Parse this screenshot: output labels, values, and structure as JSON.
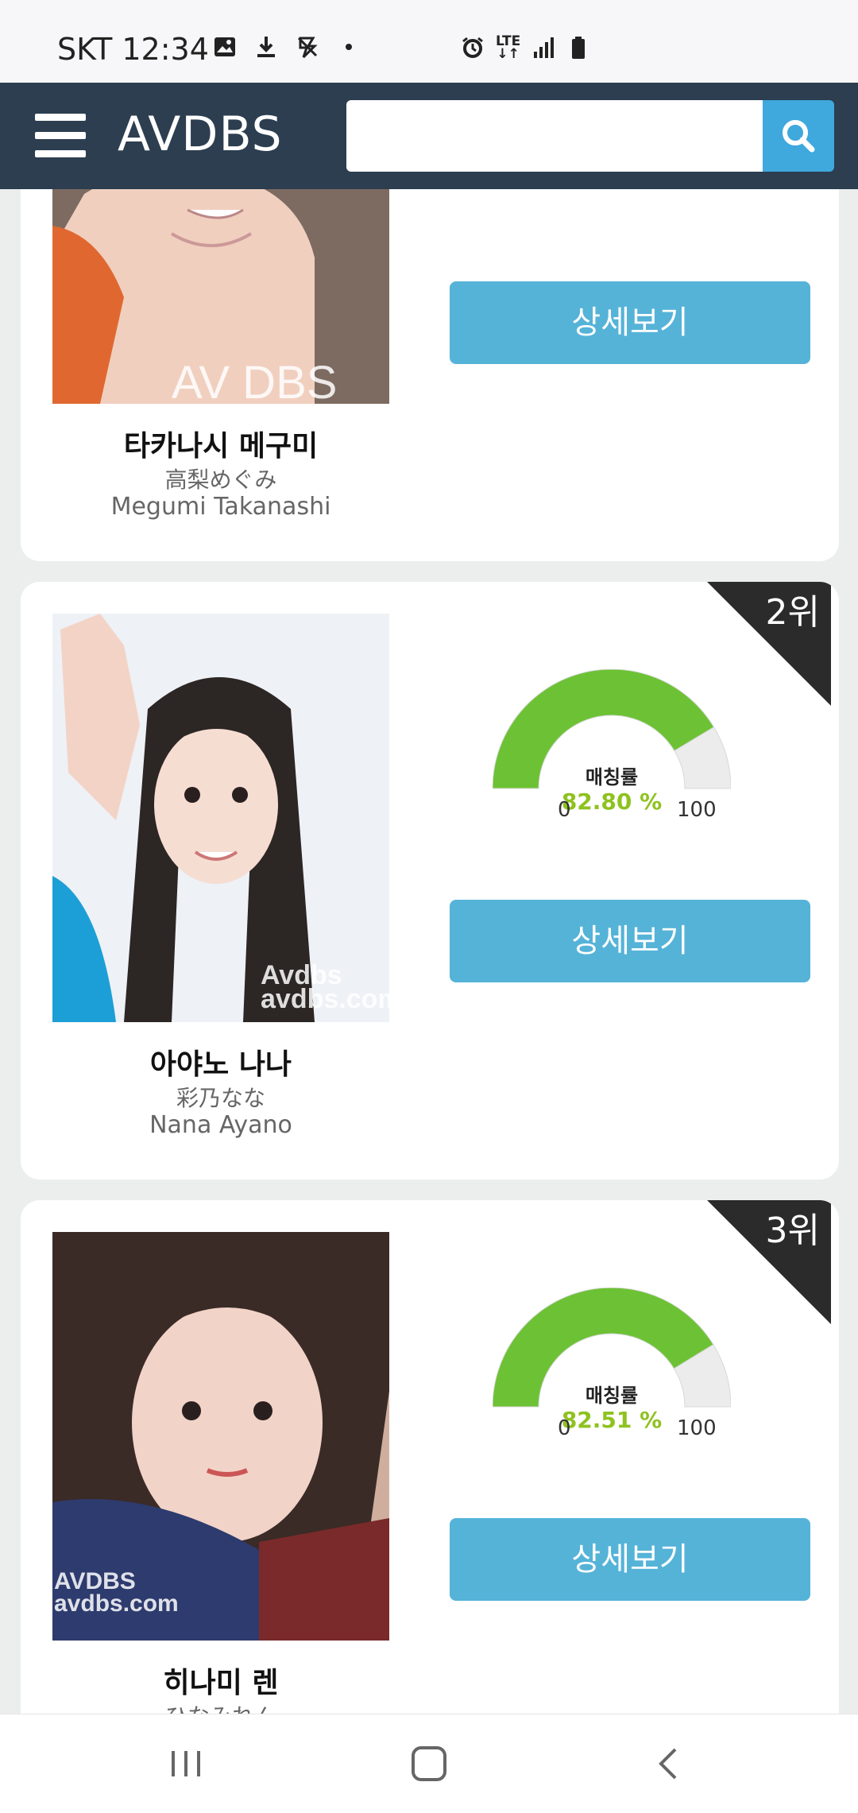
{
  "status_bar": {
    "time": "SKT 12:34",
    "icons": [
      "gallery-icon",
      "download-icon",
      "no-data-icon",
      "dot-icon",
      "alarm-icon",
      "lte-icon",
      "signal-icon",
      "battery-icon"
    ],
    "lte": "LTE"
  },
  "header": {
    "logo": "AVDBS",
    "search_placeholder": "",
    "accent": "#2c3e50",
    "search_button_color": "#3fa8dd"
  },
  "cards": [
    {
      "name_ko": "타카나시 메구미",
      "name_ja": "高梨めぐみ",
      "name_en": "Megumi Takanashi",
      "button": "상세보기",
      "watermark": "AV DBS"
    },
    {
      "rank": "2위",
      "gauge_label": "매칭률",
      "match": "82.80 %",
      "match_fraction": 0.828,
      "min": "0",
      "max": "100",
      "name_ko": "아야노 나나",
      "name_ja": "彩乃なな",
      "name_en": "Nana Ayano",
      "button": "상세보기",
      "watermark": "Avdbs avdbs.com"
    },
    {
      "rank": "3위",
      "gauge_label": "매칭률",
      "match": "82.51 %",
      "match_fraction": 0.8251,
      "min": "0",
      "max": "100",
      "name_ko": "히나미 렌",
      "name_ja": "ひなみれん",
      "button": "상세보기",
      "watermark": "AVDBS avdbs.com"
    }
  ],
  "colors": {
    "gauge_fill": "#6cc234",
    "gauge_empty": "#ececec",
    "button": "#55b3d8",
    "rank_corner": "#2b2b2b",
    "match_text": "#8ec21f"
  },
  "nav": {
    "icons": [
      "recent-apps-icon",
      "home-icon",
      "back-icon"
    ]
  }
}
